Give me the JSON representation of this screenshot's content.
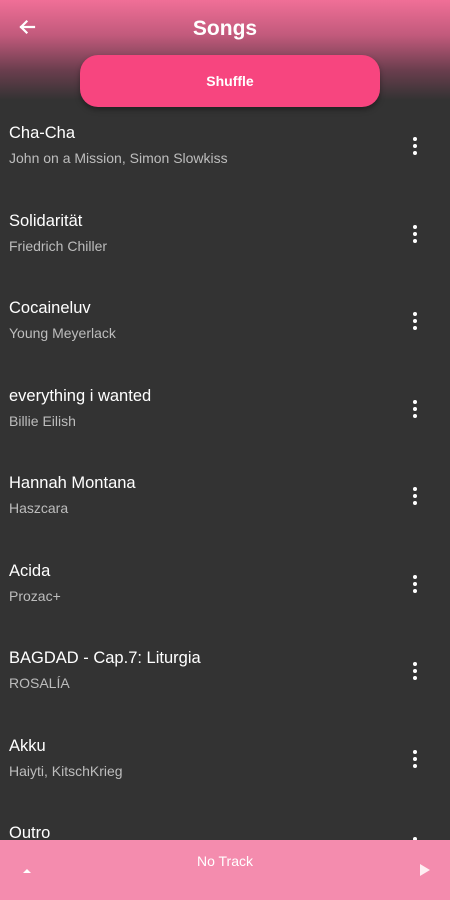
{
  "header": {
    "title": "Songs",
    "back_icon": "arrow-left-icon",
    "shuffle_label": "Shuffle"
  },
  "songs": [
    {
      "title": "Cha-Cha",
      "artist": "John on a Mission, Simon Slowkiss"
    },
    {
      "title": "Solidarität",
      "artist": "Friedrich Chiller"
    },
    {
      "title": "Cocaineluv",
      "artist": "Young Meyerlack"
    },
    {
      "title": "everything i wanted",
      "artist": "Billie Eilish"
    },
    {
      "title": "Hannah Montana",
      "artist": "Haszcara"
    },
    {
      "title": "Acida",
      "artist": "Prozac+"
    },
    {
      "title": "BAGDAD - Cap.7: Liturgia",
      "artist": "ROSALÍA"
    },
    {
      "title": "Akku",
      "artist": "Haiyti, KitschKrieg"
    },
    {
      "title": "Outro",
      "artist": ""
    }
  ],
  "player": {
    "track_label": "No Track",
    "expand_icon": "caret-up-icon",
    "play_icon": "play-icon"
  },
  "colors": {
    "accent": "#f7457f",
    "player_bar": "#f48cae",
    "background": "#333333",
    "secondary_text": "#bdbdbd"
  }
}
